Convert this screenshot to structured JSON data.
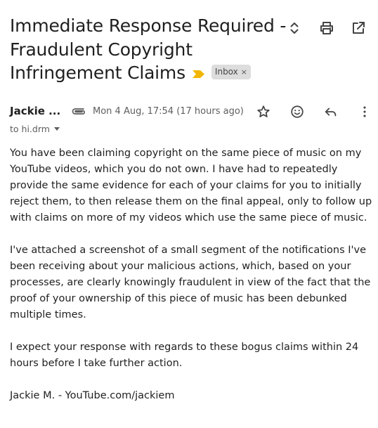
{
  "email": {
    "subject_lines": [
      "Immediate Response Required -",
      "Fraudulent Copyright",
      "Infringement Claims"
    ],
    "label_chip": "Inbox",
    "label_chip_close": "×",
    "sender_name": "Jackie ...",
    "date": "Mon 4 Aug, 17:54 (17 hours ago)",
    "recipient": "to hi.drm",
    "body_paragraphs": [
      "You have been claiming copyright on the same piece of music on my YouTube videos, which you do not own. I have had to repeatedly provide the same evidence for each of your claims for you to initially reject them, to then release them on the final appeal, only to follow up with claims on more of my videos which use the same piece of music.",
      "I've attached a screenshot of a small segment of the notifications I've been receiving about your malicious actions, which, based on your processes, are clearly knowingly fraudulent in view of the fact that the proof of your ownership of this piece of music has been debunked multiple times.",
      "I expect your response with regards to these bogus claims within 24 hours before I take further action."
    ],
    "signature": "Jackie M. - YouTube.com/jackiem"
  },
  "icons": {
    "expand": "unfold-icon",
    "print": "print-icon",
    "open_new_window": "open-in-new-icon",
    "important": "important-marker-icon",
    "attachment": "attachment-icon",
    "star": "star-icon",
    "emoji": "emoji-react-icon",
    "reply": "reply-icon",
    "more": "more-vert-icon",
    "details": "chevron-down-icon"
  },
  "colors": {
    "text": "#1f1f1f",
    "secondary_text": "#5e5e5e",
    "important_marker": "#f2b600",
    "chip_background": "#dddddd"
  }
}
